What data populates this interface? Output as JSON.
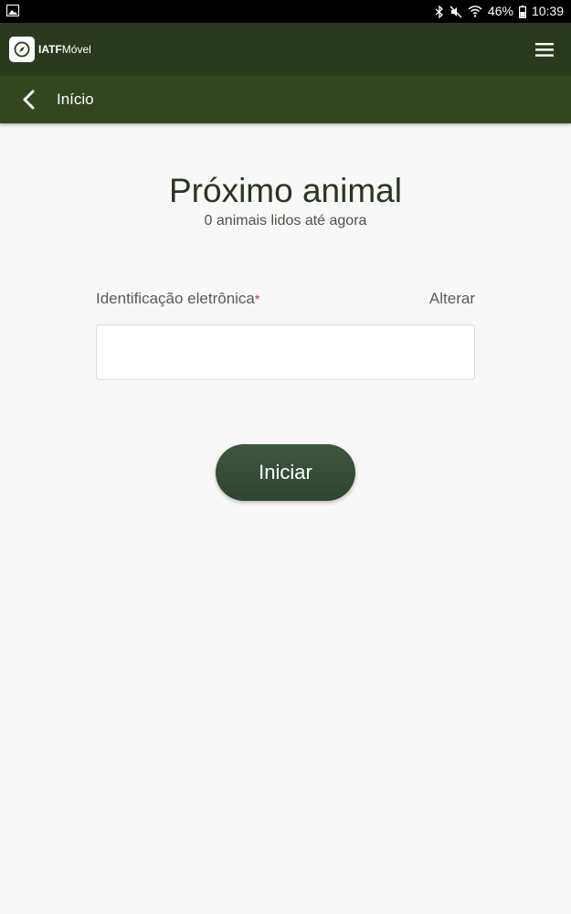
{
  "status_bar": {
    "battery": "46%",
    "time": "10:39"
  },
  "app_bar": {
    "logo_bold": "IATF",
    "logo_light": "Móvel"
  },
  "nav": {
    "title": "Início"
  },
  "main": {
    "title": "Próximo animal",
    "subtitle": "0 animais lidos até agora",
    "field_label": "Identificação eletrônica",
    "required_mark": "*",
    "alter_label": "Alterar",
    "input_value": "",
    "start_button": "Iniciar"
  },
  "colors": {
    "app_bar": "#2b3a1d",
    "nav_bar": "#34461f",
    "button": "#34493a",
    "required": "#d32f2f"
  },
  "icons": {
    "status_left": "image-icon",
    "bluetooth": "bluetooth-icon",
    "mute": "mute-icon",
    "wifi": "wifi-icon",
    "battery": "battery-icon",
    "logo": "compass-icon",
    "menu": "hamburger-menu-icon",
    "back": "chevron-left-icon"
  }
}
